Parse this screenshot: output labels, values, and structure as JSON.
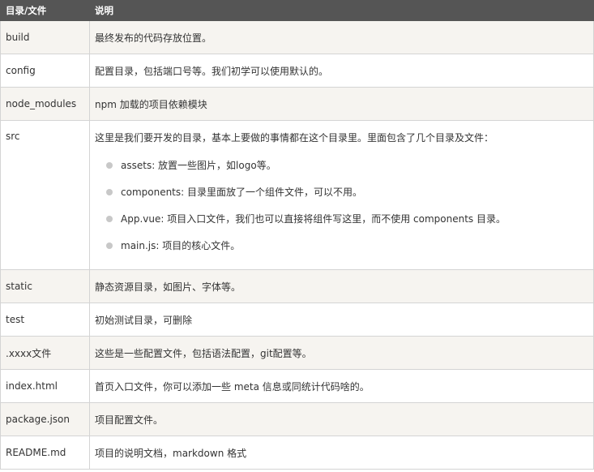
{
  "headers": {
    "name": "目录/文件",
    "desc": "说明"
  },
  "rows": [
    {
      "name": "build",
      "desc": "最终发布的代码存放位置。"
    },
    {
      "name": "config",
      "desc": "配置目录，包括端口号等。我们初学可以使用默认的。"
    },
    {
      "name": "node_modules",
      "desc": "npm 加载的项目依赖模块"
    },
    {
      "name": "src",
      "desc": "这里是我们要开发的目录，基本上要做的事情都在这个目录里。里面包含了几个目录及文件：",
      "items": [
        "assets: 放置一些图片，如logo等。",
        "components: 目录里面放了一个组件文件，可以不用。",
        "App.vue: 项目入口文件，我们也可以直接将组件写这里，而不使用 components 目录。",
        "main.js: 项目的核心文件。"
      ]
    },
    {
      "name": "static",
      "desc": "静态资源目录，如图片、字体等。"
    },
    {
      "name": "test",
      "desc": "初始测试目录，可删除"
    },
    {
      "name": ".xxxx文件",
      "desc": "这些是一些配置文件，包括语法配置，git配置等。"
    },
    {
      "name": "index.html",
      "desc": "首页入口文件，你可以添加一些 meta 信息或同统计代码啥的。"
    },
    {
      "name": "package.json",
      "desc": "项目配置文件。"
    },
    {
      "name": "README.md",
      "desc": "项目的说明文档，markdown 格式"
    }
  ]
}
